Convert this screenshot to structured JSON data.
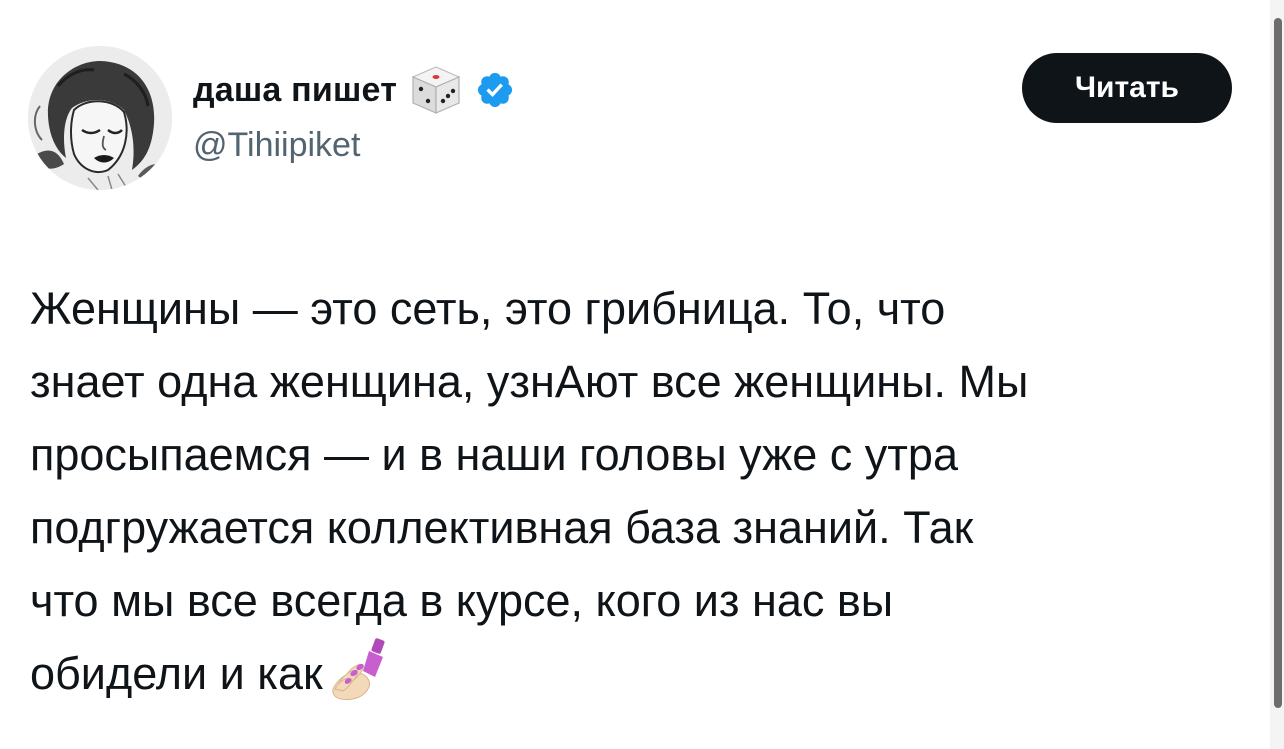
{
  "tweet": {
    "author": {
      "display_name": "даша пишет",
      "handle": "@Tihiipiket",
      "name_emoji": "dice-icon",
      "verified": true,
      "verified_icon": "verified-badge-icon",
      "avatar": "avatar-illustration"
    },
    "follow_button_label": "Читать",
    "text_lines": [
      "Женщины — это сеть, это грибница. То, что",
      "знает одна женщина, узнАют все женщины. Мы",
      "просыпаемся — и в наши головы уже с утра",
      "подгружается коллективная база знаний. Так",
      "что мы все всегда в курсе, кого из нас вы",
      "обидели и как"
    ],
    "text_end_emoji": "nail-polish-icon"
  },
  "colors": {
    "text": "#0f1419",
    "secondary_text": "#536471",
    "button_bg": "#0f1419",
    "button_text": "#ffffff",
    "verified": "#1d9bf0"
  }
}
